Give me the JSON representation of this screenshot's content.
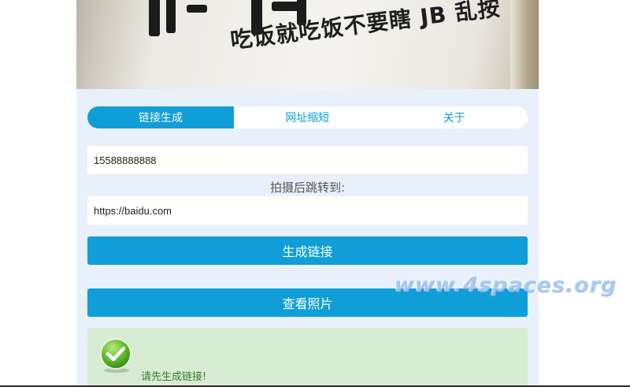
{
  "banner": {
    "sign_text": "吃饭就吃饭不要瞎 JB 乱按"
  },
  "tabs": [
    {
      "label": "链接生成",
      "active": true
    },
    {
      "label": "网址缩短",
      "active": false
    },
    {
      "label": "关于",
      "active": false
    }
  ],
  "form": {
    "phone_value": "15588888888",
    "redirect_label": "拍摄后跳转到:",
    "redirect_value": "https://baidu.com",
    "generate_button": "生成链接",
    "view_button": "查看照片"
  },
  "alert": {
    "message": "请先生成链接!"
  },
  "watermark": "www.4spaces.org",
  "colors": {
    "accent": "#0f9ed8",
    "panel_bg": "#e8f1fb",
    "alert_bg": "#d7ecd2",
    "alert_text": "#3a7a30"
  }
}
